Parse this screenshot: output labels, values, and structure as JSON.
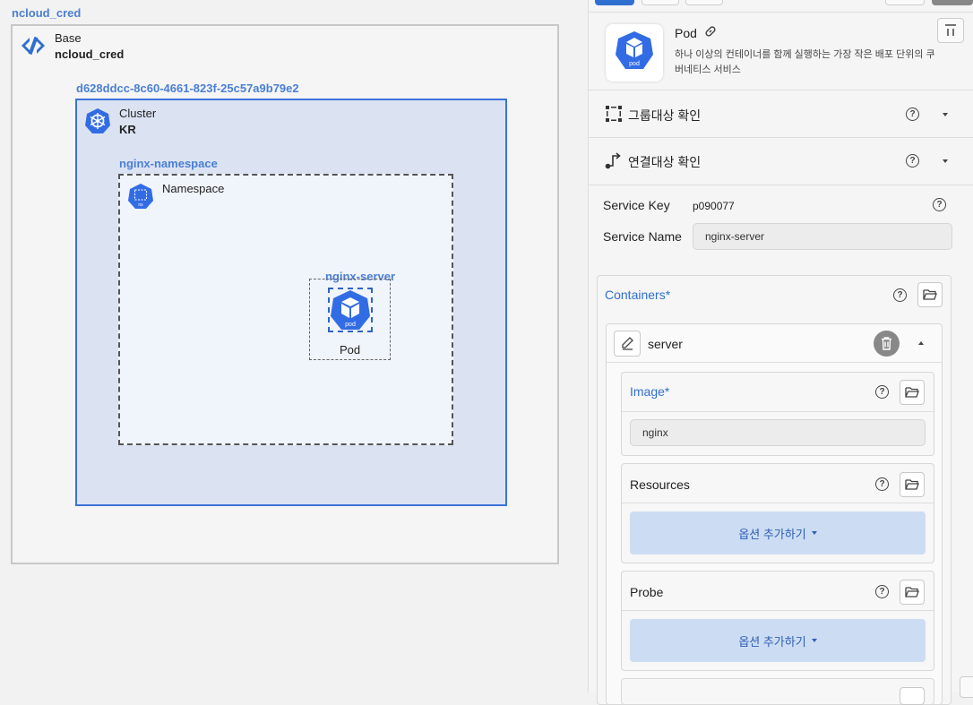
{
  "canvas": {
    "base_label": "ncloud_cred",
    "base_type": "Base",
    "base_name": "ncloud_cred",
    "cluster_label": "d628ddcc-8c60-4661-823f-25c57a9b79e2",
    "cluster_type": "Cluster",
    "cluster_name": "KR",
    "namespace_label": "nginx-namespace",
    "namespace_type": "Namespace",
    "pod_label": "nginx-server",
    "pod_type": "Pod",
    "pod_icon_text": "pod",
    "ns_icon_text": "ns"
  },
  "panel": {
    "title": "Pod",
    "description": "하나 이상의 컨테이너를 함께 실행하는 가장 작은 배포 단위의 쿠버네티스 서비스",
    "icon_text": "pod",
    "group_target": "그룹대상 확인",
    "link_target": "연결대상 확인",
    "service_key_label": "Service Key",
    "service_key_value": "p090077",
    "service_name_label": "Service Name",
    "service_name_value": "nginx-server",
    "containers_label": "Containers*",
    "container_name": "server",
    "image_label": "Image*",
    "image_value": "nginx",
    "resources_label": "Resources",
    "probe_label": "Probe",
    "add_option_label": "옵션 추가하기",
    "help_glyph": "?"
  },
  "colors": {
    "accent": "#2f6fd0",
    "cluster_border": "#3d73d8",
    "cluster_fill": "#dbe3f3",
    "k8s_blue": "#326ce5"
  }
}
